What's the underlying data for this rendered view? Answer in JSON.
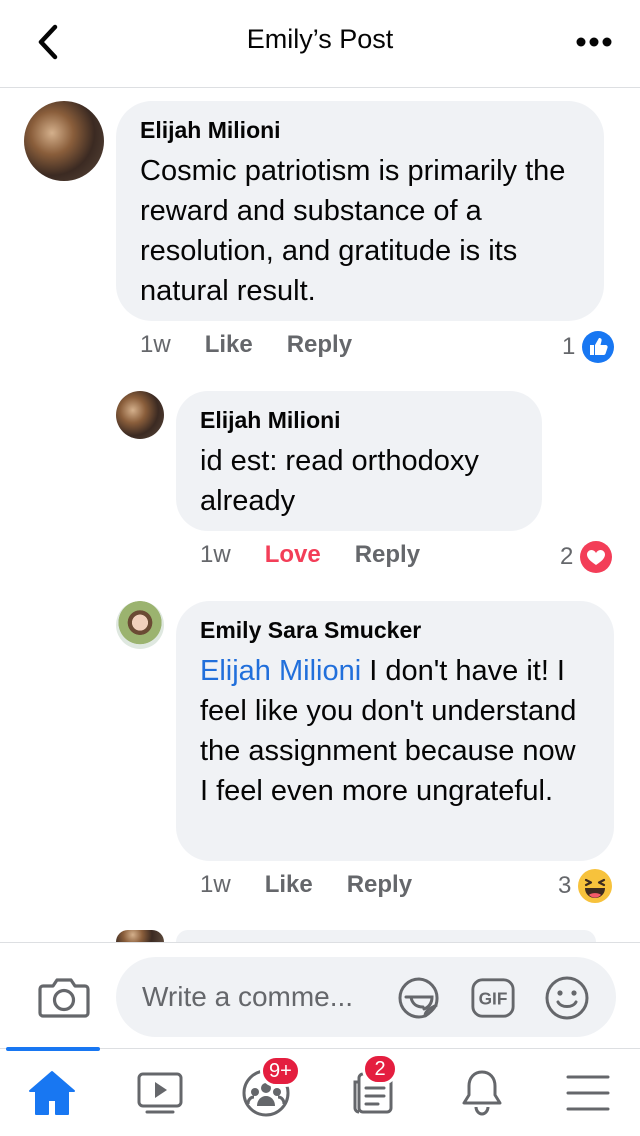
{
  "header": {
    "title": "Emily’s Post"
  },
  "comments": [
    {
      "author": "Elijah Milioni",
      "text": "Cosmic patriotism is primarily the reward and substance of a resolution, and gratitude is its natural result.",
      "time": "1w",
      "action": "Like",
      "reply": "Reply",
      "reaction_count": "1",
      "reaction": "like-icon"
    },
    {
      "author": "Elijah Milioni",
      "text": "id est: read orthodoxy already",
      "time": "1w",
      "action": "Love",
      "reply": "Reply",
      "reaction_count": "2",
      "reaction": "heart-icon"
    },
    {
      "author": "Emily Sara Smucker",
      "mention": "Elijah Milioni",
      "text": " I don't have it! I feel like you don't understand the assignment because now I feel even more ungrateful.",
      "time": "1w",
      "action": "Like",
      "reply": "Reply",
      "reaction_count": "3",
      "reaction": "laughing-emoji-icon"
    }
  ],
  "composer": {
    "placeholder": "Write a comme...",
    "gif_label": "GIF"
  },
  "tabbar": {
    "groups_badge": "9+",
    "feeds_badge": "2"
  },
  "colors": {
    "accent": "#1877f2",
    "love": "#f33e58",
    "bubble": "#f0f2f5",
    "badge": "#e41e3f",
    "secondary_text": "#65676b"
  }
}
